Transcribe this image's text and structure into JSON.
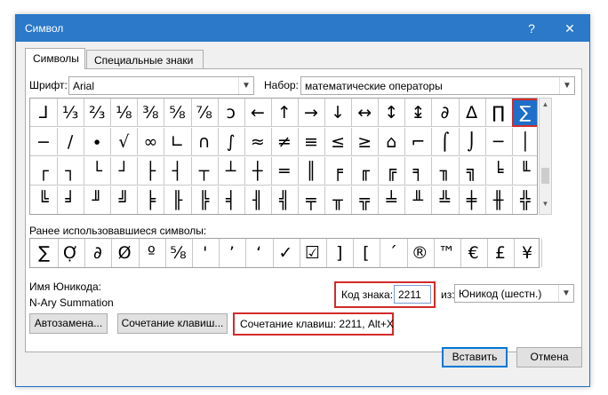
{
  "window": {
    "title": "Символ",
    "help_glyph": "?",
    "close_glyph": "✕"
  },
  "tabs": [
    "Символы",
    "Специальные знаки"
  ],
  "font": {
    "label": "Шрифт:",
    "value": "Arial"
  },
  "subset": {
    "label": "Набор:",
    "value": "математические операторы"
  },
  "symbol_grid": [
    [
      "⅃",
      "⅓",
      "⅔",
      "⅛",
      "⅜",
      "⅝",
      "⅞",
      "ↄ",
      "←",
      "↑",
      "→",
      "↓",
      "↔",
      "↕",
      "↨",
      "∂",
      "∆",
      "∏",
      "∑"
    ],
    [
      "−",
      "∕",
      "∙",
      "√",
      "∞",
      "∟",
      "∩",
      "∫",
      "≈",
      "≠",
      "≡",
      "≤",
      "≥",
      "⌂",
      "⌐",
      "⌠",
      "⌡",
      "─",
      "│"
    ],
    [
      "┌",
      "┐",
      "└",
      "┘",
      "├",
      "┤",
      "┬",
      "┴",
      "┼",
      "═",
      "║",
      "╒",
      "╓",
      "╔",
      "╕",
      "╖",
      "╗",
      "╘",
      "╙"
    ],
    [
      "╚",
      "╛",
      "╜",
      "╝",
      "╞",
      "╟",
      "╠",
      "╡",
      "╢",
      "╣",
      "╤",
      "╥",
      "╦",
      "╧",
      "╨",
      "╩",
      "╪",
      "╫",
      "╬"
    ]
  ],
  "selected_symbol": "∑",
  "recent": {
    "label": "Ранее использовавшиеся символы:",
    "symbols": [
      "∑",
      "Ợ",
      "∂",
      "Ø",
      "º",
      "⅝",
      "'",
      "’",
      "‘",
      "✓",
      "☑",
      "]",
      "[",
      "´",
      "®",
      "™",
      "€",
      "£",
      "¥"
    ]
  },
  "unicode_name": {
    "label": "Имя Юникода:",
    "value": "N-Ary Summation"
  },
  "char_code": {
    "label": "Код знака:",
    "value": "2211"
  },
  "from": {
    "label": "из:",
    "value": "Юникод (шестн.)"
  },
  "buttons": {
    "autocorrect": "Автозамена...",
    "shortcut_key": "Сочетание клавиш...",
    "insert": "Вставить",
    "cancel": "Отмена"
  },
  "shortcut_info": "Сочетание клавиш: 2211, Alt+X"
}
